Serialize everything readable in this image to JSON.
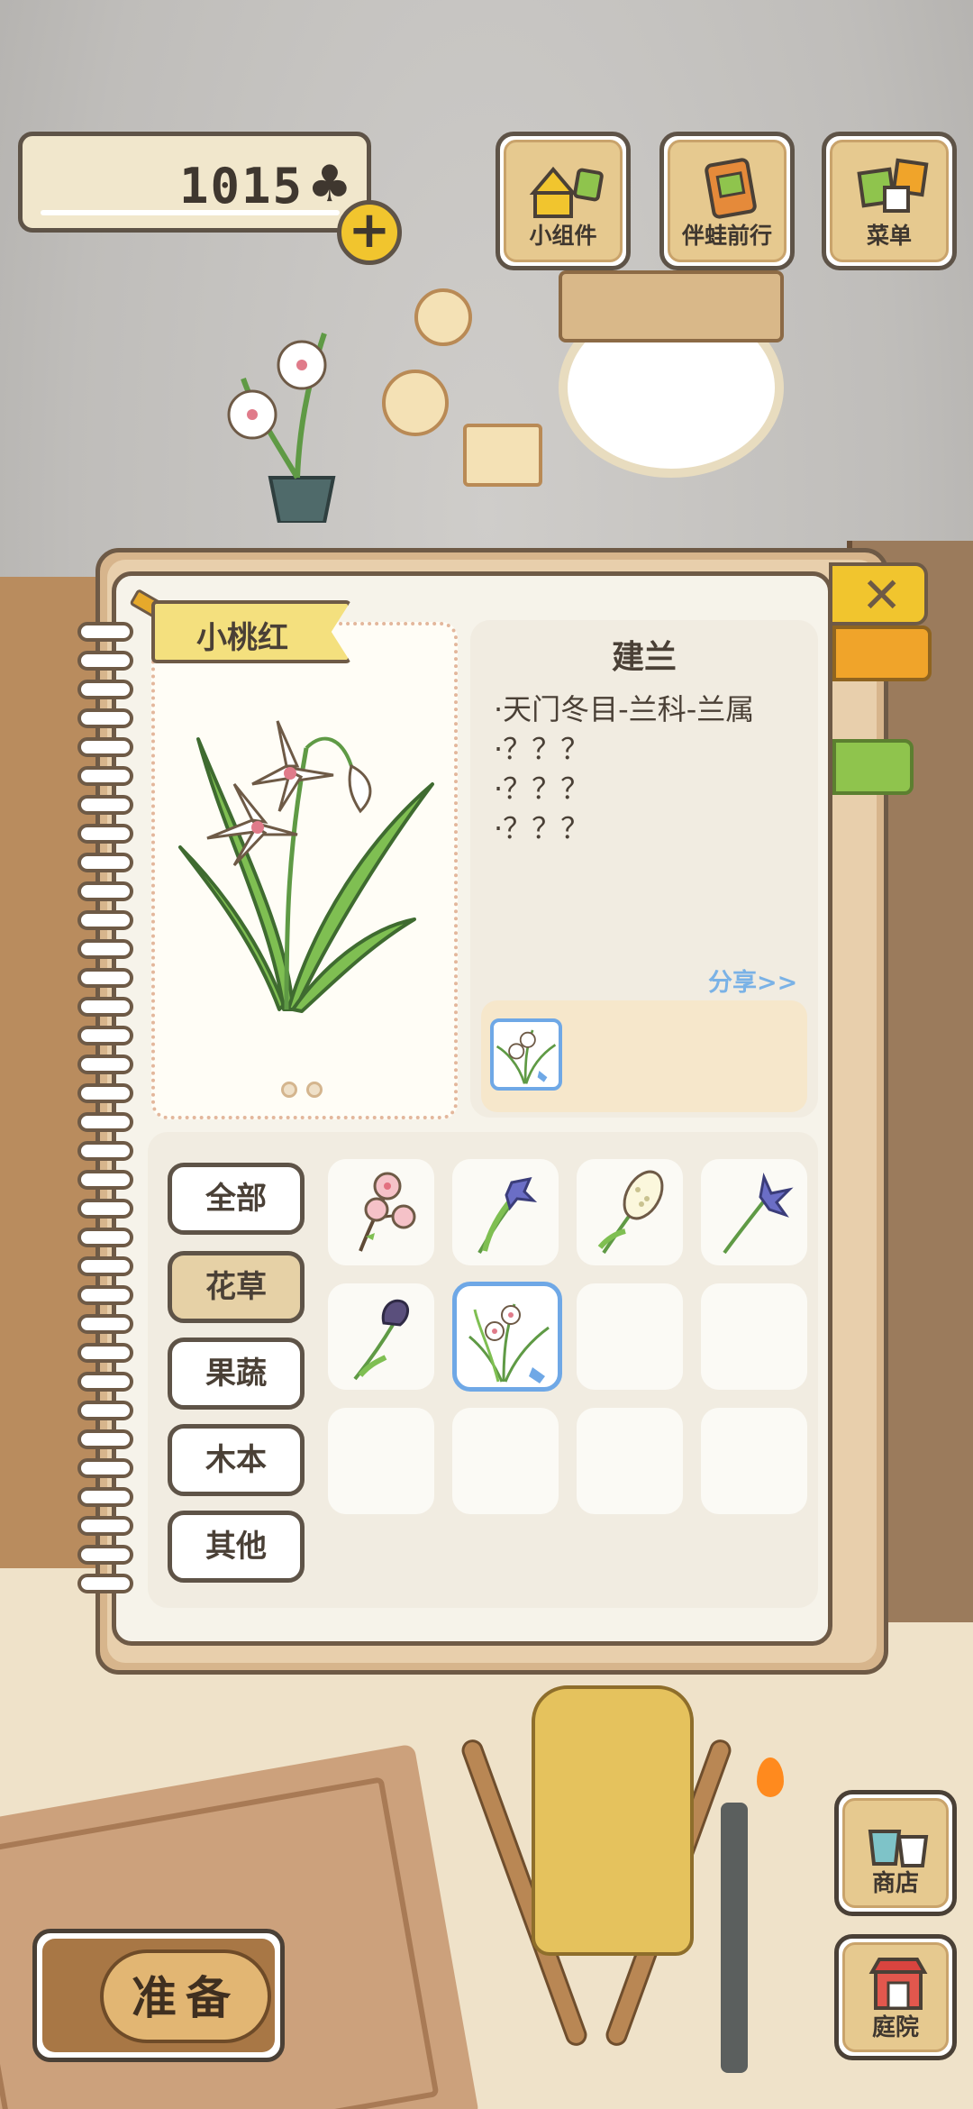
{
  "hud": {
    "currency_amount": "1015",
    "currency_symbol": "♣",
    "plus_label": "+",
    "buttons": [
      {
        "label": "小组件",
        "icon": "widget-icon"
      },
      {
        "label": "伴蛙前行",
        "icon": "book-icon"
      },
      {
        "label": "菜单",
        "icon": "menu-cards-icon"
      }
    ]
  },
  "notebook": {
    "close_label": "✕",
    "selected_item": {
      "name": "小桃红",
      "title": "建兰",
      "details": [
        "·天门冬目-兰科-兰属",
        "·？？？",
        "·？？？",
        "·？？？"
      ],
      "share_label": "分享>>"
    },
    "categories": [
      {
        "label": "全部",
        "active": false
      },
      {
        "label": "花草",
        "active": true
      },
      {
        "label": "果蔬",
        "active": false
      },
      {
        "label": "木本",
        "active": false
      },
      {
        "label": "其他",
        "active": false
      }
    ],
    "grid_items": [
      {
        "name": "peach-blossom",
        "filled": true
      },
      {
        "name": "iris-purple",
        "filled": true
      },
      {
        "name": "hyacinth-white",
        "filled": true
      },
      {
        "name": "bellflower-blue",
        "filled": true
      },
      {
        "name": "tulip-purple",
        "filled": true
      },
      {
        "name": "orchid-selected",
        "filled": true,
        "selected": true
      },
      {
        "name": "empty",
        "filled": false
      },
      {
        "name": "empty",
        "filled": false
      },
      {
        "name": "empty",
        "filled": false
      },
      {
        "name": "empty",
        "filled": false
      },
      {
        "name": "empty",
        "filled": false
      },
      {
        "name": "empty",
        "filled": false
      }
    ]
  },
  "bottom": {
    "prepare_label": "准备",
    "shop_label": "商店",
    "yard_label": "庭院"
  },
  "colors": {
    "accent_yellow": "#f1c52e",
    "selection_blue": "#6fa8e6",
    "outline": "#5e5347",
    "page": "#f6f3ea"
  }
}
